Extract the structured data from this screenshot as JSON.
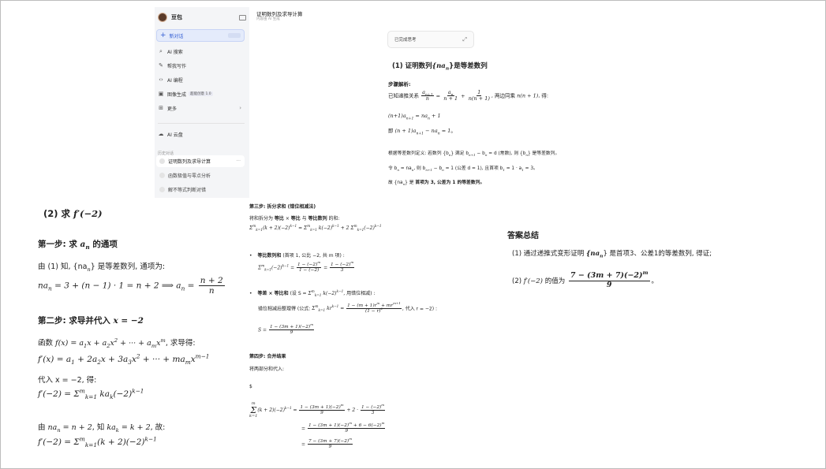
{
  "sidebar": {
    "app_name": "豆包",
    "new_chat": "新对话",
    "items": [
      {
        "label": "AI 搜索",
        "icon": "search-icon"
      },
      {
        "label": "帮我写作",
        "icon": "pen-icon"
      },
      {
        "label": "AI 编程",
        "icon": "code-icon"
      },
      {
        "label": "图像生成",
        "icon": "image-icon",
        "badge": "超能创意 1.0"
      },
      {
        "label": "更多",
        "icon": "grid-icon"
      },
      {
        "label": "AI 云盘",
        "icon": "cloud-icon"
      }
    ],
    "history_label": "历史对话",
    "history": [
      {
        "label": "证明数列及求导计算",
        "active": true
      },
      {
        "label": "函数极值与零点分析",
        "active": false
      },
      {
        "label": "解不等式判断对错",
        "active": false
      }
    ]
  },
  "chat": {
    "title": "证明数列及求导计算",
    "subtitle": "内容由 AI 生成",
    "thinking_label": "已完成思考"
  },
  "part1": {
    "heading_pre": "(1) 证明数列",
    "heading_math": "{na",
    "heading_sub": "n",
    "heading_post": "}是等差数列",
    "steps_label": "步骤解析:",
    "line1_pre": "已知递推关系",
    "line1_post": ", 两边同乘",
    "line1_tail": ", 得:",
    "line2": "(n+1)a",
    "line3_pre": "即",
    "line4": "根据等差数列定义: 若数列 {b",
    "line4b": "} 满足 b",
    "line4c": " − b",
    "line4d": " = d (常数), 则 {b",
    "line4e": "} 是等差数列。",
    "line5": "令 b",
    "line5b": " = na",
    "line5c": ", 则 b",
    "line5d": " − b",
    "line5e": " = 1 (公差 d = 1), 且首项 b",
    "line5f": " = 1 · a",
    "line5g": " = 3。",
    "line6_pre": "故 {na",
    "line6_mid": "} 是 ",
    "line6_bold": "首项为 3, 公差为 1 的等差数列。"
  },
  "left": {
    "heading": "(2) 求",
    "step1": "第一步: 求",
    "step1_tail": "的通项",
    "step1_line": "由 (1) 知, {na",
    "step1_line_tail": "} 是等差数列, 通项为:",
    "step2": "第二步: 求导并代入",
    "step2_math": "x = −2",
    "func_line_pre": "函数",
    "func_line_tail": ", 求导得:",
    "sub_line": "代入 x = −2, 得:",
    "by_line_pre": "由",
    "by_line_mid": ", 知",
    "by_line_tail": ", 故:"
  },
  "middle": {
    "step3": "第三步: 拆分求和 (错位相减法)",
    "split_line_pre": "将和拆分为 ",
    "split_b1": "等比",
    "split_mid": " × ",
    "split_b2": "等比",
    "split_mid2": " 与 ",
    "split_b3": "等比数列",
    "split_tail": " 的和:",
    "bullet1_b": "等比数列和",
    "bullet1_tail": " (首项 1, 公比 −2, 共 m 项) :",
    "bullet2_b": "等差 × 等比和",
    "bullet2_tail": " (设 S = ",
    "bullet2_tail2": ", 用错位相减) :",
    "bullet2_sub": "错位相减后整理得 (公式:",
    "bullet2_sub_tail": ", 代入 r = −2) :",
    "step4": "第四步: 合并结果",
    "step4_line": "将两部分和代入:",
    "dollar": "$"
  },
  "answer": {
    "title": "答案总结",
    "line1_pre": "(1) 通过递推式变形证明 ",
    "line1_math": "{na",
    "line1_post": "} 是首项3、公差1的等差数列, 得证;",
    "line2_pre": "(2)",
    "line2_mid": "的值为",
    "line2_tail": "。"
  }
}
